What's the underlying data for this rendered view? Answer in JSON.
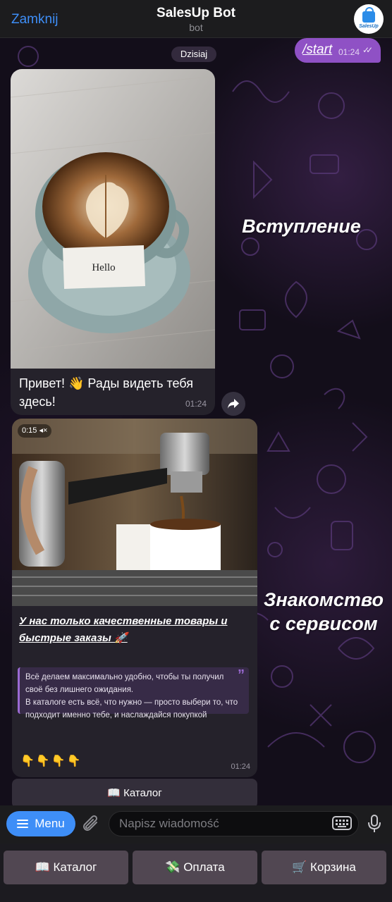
{
  "header": {
    "close_label": "Zamknij",
    "title": "SalesUp Bot",
    "subtitle": "bot",
    "avatar_text": "SalesUp"
  },
  "chat": {
    "date_label": "Dzisiaj",
    "outgoing": {
      "text": "/start",
      "time": "01:24",
      "status_icon": "double-check-icon"
    },
    "message1": {
      "photo_caption": "Hello",
      "text": "Привет! 👋 Рады видеть тебя здесь!",
      "time": "01:24"
    },
    "message2": {
      "video_duration": "0:15",
      "headline": "У нас только качественные товары и быстрые заказы 🚀",
      "quote_lines": [
        "Всё делаем максимально удобно, чтобы ты получил",
        "своё без лишнего ожидания.",
        "В каталоге есть всё, что нужно — просто выбери то, что",
        "подходит именно тебе, и наслаждайся покупкой"
      ],
      "emojis": "👇👇👇👇",
      "time": "01:24",
      "inline_button": "📖 Каталог"
    }
  },
  "annotations": {
    "intro_label": "Вступление",
    "service_label_line1": "Знакомство",
    "service_label_line2": "с сервисом"
  },
  "input": {
    "menu_label": "Menu",
    "placeholder": "Napisz wiadomość"
  },
  "reply_keyboard": {
    "buttons": [
      "📖 Каталог",
      "💸 Оплата",
      "🛒 Корзина"
    ]
  },
  "colors": {
    "accent_blue": "#3e8ef7",
    "outgoing_bubble": "#8f51c5",
    "incoming_bubble": "#25222b",
    "quote_border": "#9b6ad3"
  }
}
